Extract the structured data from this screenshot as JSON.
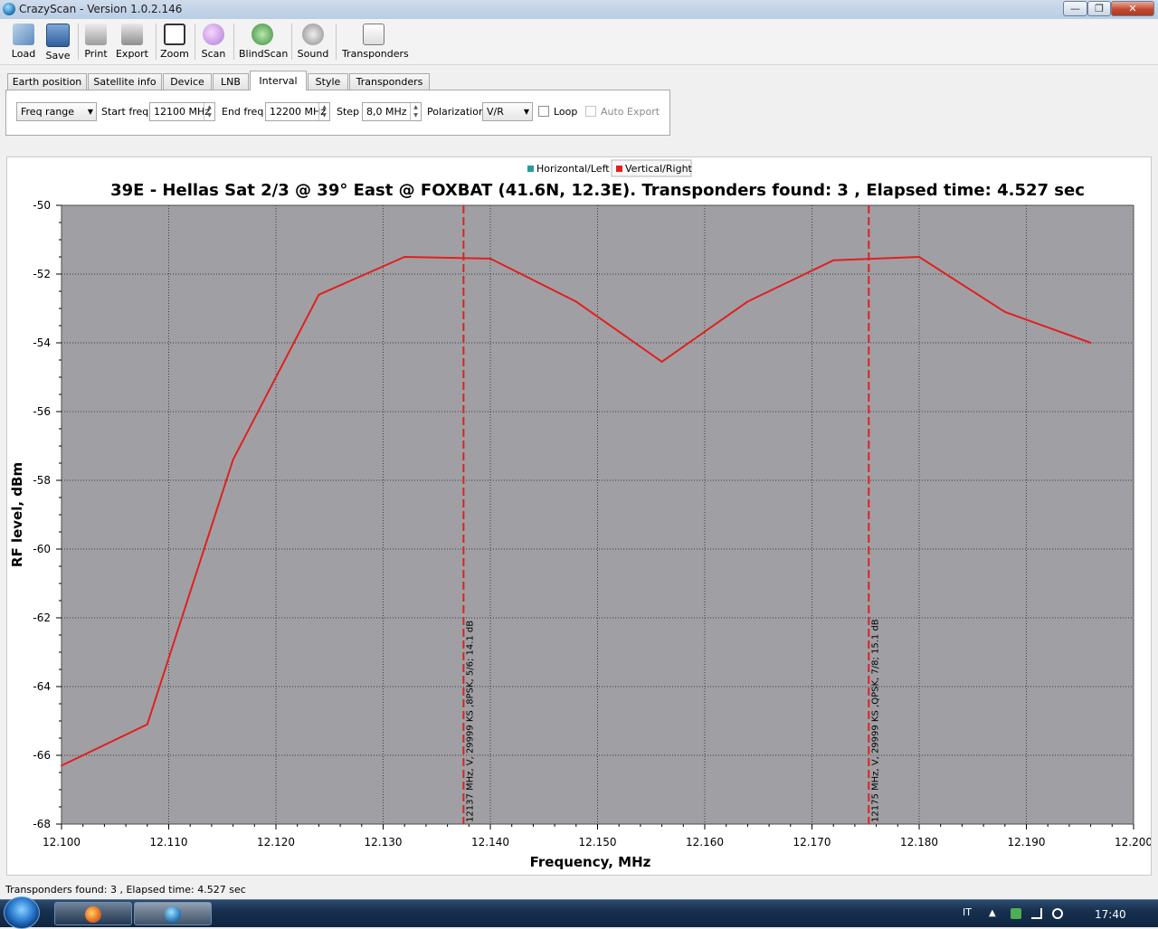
{
  "window": {
    "title": "CrazyScan - Version 1.0.2.146",
    "min_label": "—",
    "max_label": "❐",
    "close_label": "✕"
  },
  "toolbar": {
    "buttons": [
      {
        "label": "Load",
        "icon": "load-icon"
      },
      {
        "label": "Save",
        "icon": "save-icon"
      },
      {
        "label": "Print",
        "icon": "print-icon"
      },
      {
        "label": "Export",
        "icon": "export-icon"
      },
      {
        "label": "Zoom",
        "icon": "zoom-icon"
      },
      {
        "label": "Scan",
        "icon": "scan-icon"
      },
      {
        "label": "BlindScan",
        "icon": "blindscan-icon"
      },
      {
        "label": "Sound",
        "icon": "sound-icon"
      },
      {
        "label": "Transponders",
        "icon": "transponders-icon"
      }
    ]
  },
  "tabs": [
    {
      "label": "Earth position"
    },
    {
      "label": "Satellite info"
    },
    {
      "label": "Device"
    },
    {
      "label": "LNB"
    },
    {
      "label": "Interval",
      "active": true
    },
    {
      "label": "Style"
    },
    {
      "label": "Transponders"
    }
  ],
  "interval": {
    "mode": "Freq range",
    "start_label": "Start freq",
    "start_value": "12100 MHz",
    "end_label": "End freq",
    "end_value": "12200 MHz",
    "step_label": "Step",
    "step_value": "8,0 MHz",
    "polarization_label": "Polarization",
    "polarization_value": "V/R",
    "loop_label": "Loop",
    "auto_export_label": "Auto Export"
  },
  "colors": {
    "plot_bg": "#a0a0a4",
    "series_red": "#e02020",
    "series_teal": "#2a9a9a"
  },
  "chart_data": {
    "type": "line",
    "title": "39E - Hellas Sat 2/3 @ 39° East @ FOXBAT (41.6N, 12.3E). Transponders found: 3 , Elapsed time: 4.527 sec",
    "xlabel": "Frequency, MHz",
    "ylabel": "RF level, dBm",
    "xlim": [
      12100,
      12200
    ],
    "ylim": [
      -68,
      -50
    ],
    "x_ticks": [
      "12.100",
      "12.110",
      "12.120",
      "12.130",
      "12.140",
      "12.150",
      "12.160",
      "12.170",
      "12.180",
      "12.190",
      "12.200"
    ],
    "y_ticks": [
      "-50",
      "-52",
      "-54",
      "-56",
      "-58",
      "-60",
      "-62",
      "-64",
      "-66",
      "-68"
    ],
    "grid": true,
    "legend": [
      {
        "name": "Horizontal/Left",
        "color": "#2a9a9a"
      },
      {
        "name": "Vertical/Right",
        "color": "#e02020"
      }
    ],
    "series": [
      {
        "name": "Vertical/Right",
        "x": [
          12100,
          12108,
          12116,
          12124,
          12132,
          12140,
          12148,
          12156,
          12164,
          12172,
          12180,
          12188,
          12196
        ],
        "y": [
          -66.3,
          -65.1,
          -57.4,
          -52.6,
          -51.5,
          -51.55,
          -52.8,
          -54.55,
          -52.8,
          -51.6,
          -51.5,
          -53.1,
          -54.0
        ]
      }
    ],
    "markers": [
      {
        "x": 12137.5,
        "label": "12137 MHz, V, 29999 KS ,8PSK, 5/6; 14.1 dB"
      },
      {
        "x": 12175.3,
        "label": "12175 MHz, V, 29999 KS ,QPSK, 7/8; 15.1 dB"
      }
    ]
  },
  "status": {
    "text": "Transponders found: 3 , Elapsed time: 4.527 sec"
  },
  "taskbar": {
    "lang": "IT",
    "clock": "17:40",
    "tray_up": "▲"
  }
}
